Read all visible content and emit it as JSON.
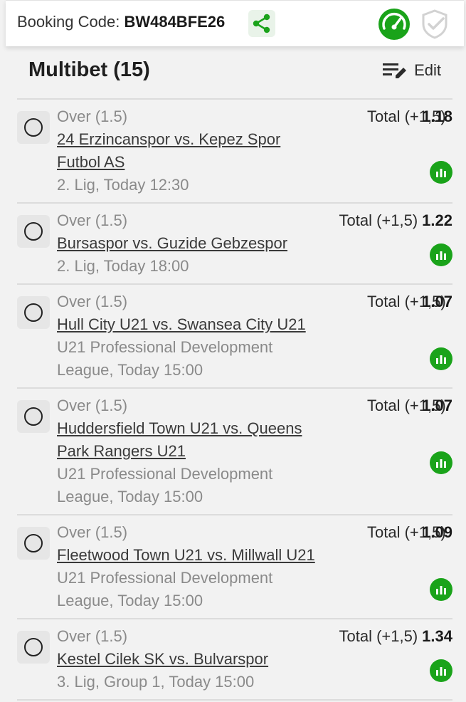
{
  "header": {
    "booking_label": "Booking Code:",
    "booking_code": "BW484BFE26",
    "share_icon": "share-icon",
    "speed_icon": "speedometer-icon",
    "shield_icon": "shield-check-icon"
  },
  "betslip": {
    "title": "Multibet (15)",
    "edit_label": "Edit",
    "edit_icon": "edit-list-icon"
  },
  "bets": [
    {
      "market": "Over (1.5)",
      "match": "24 Erzincanspor vs. Kepez Spor Futbol AS",
      "league": "2. Lig, Today 12:30",
      "pick": "Total (+1,5)",
      "odd": "1.18"
    },
    {
      "market": "Over (1.5)",
      "match": "Bursaspor vs. Guzide Gebzespor",
      "league": "2. Lig, Today 18:00",
      "pick": "Total (+1,5)",
      "odd": "1.22"
    },
    {
      "market": "Over (1.5)",
      "match": "Hull City U21 vs. Swansea City U21",
      "league": "U21 Professional Development League, Today 15:00",
      "pick": "Total (+1,5)",
      "odd": "1.07"
    },
    {
      "market": "Over (1.5)",
      "match": "Huddersfield Town U21 vs. Queens Park Rangers U21",
      "league": "U21 Professional Development League, Today 15:00",
      "pick": "Total (+1,5)",
      "odd": "1.07"
    },
    {
      "market": "Over (1.5)",
      "match": "Fleetwood Town U21 vs. Millwall U21",
      "league": "U21 Professional Development League, Today 15:00",
      "pick": "Total (+1,5)",
      "odd": "1.09"
    },
    {
      "market": "Over (1.5)",
      "match": "Kestel Cilek SK vs. Bulvarspor",
      "league": "3. Lig, Group 1, Today 15:00",
      "pick": "Total (+1,5)",
      "odd": "1.34"
    }
  ],
  "colors": {
    "accent_green": "#1aa31a",
    "background": "#f2f2f2"
  }
}
